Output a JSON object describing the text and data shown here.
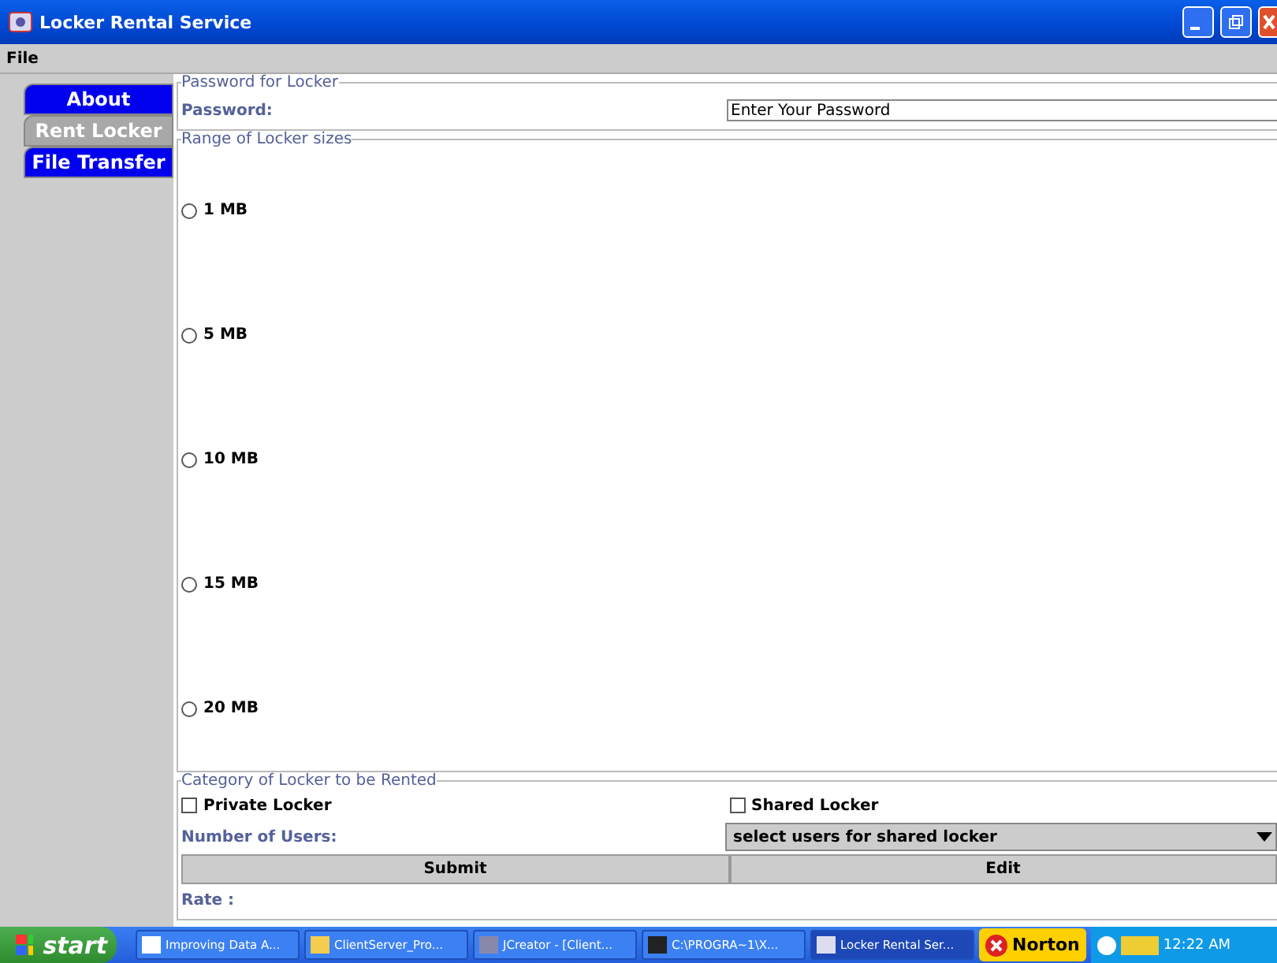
{
  "window": {
    "title": "Locker Rental Service"
  },
  "menu": [
    "File"
  ],
  "tabs": [
    {
      "label": "About",
      "selected": false
    },
    {
      "label": "Rent Locker",
      "selected": true
    },
    {
      "label": "File Transfer",
      "selected": false
    }
  ],
  "password_group": {
    "title": "Password for Locker",
    "label": "Password:",
    "value": "Enter Your Password"
  },
  "sizes_group": {
    "title": "Range of Locker sizes",
    "options": [
      {
        "label": "1 MB",
        "selected": false
      },
      {
        "label": "5 MB",
        "selected": false
      },
      {
        "label": "10 MB",
        "selected": false
      },
      {
        "label": "15 MB",
        "selected": false
      },
      {
        "label": "20 MB",
        "selected": false
      }
    ]
  },
  "category_group": {
    "title": "Category of Locker to be Rented",
    "checkboxes": [
      {
        "label": "Private Locker",
        "checked": false
      },
      {
        "label": "Shared Locker",
        "checked": false
      }
    ],
    "users_label": "Number of Users:",
    "users_select": "select users for shared locker",
    "buttons": [
      "Submit",
      "Edit"
    ],
    "rate_label": "Rate :"
  },
  "taskbar": {
    "start": "start",
    "tasks": [
      {
        "label": "Improving Data A...",
        "kind": "doc",
        "selected": false
      },
      {
        "label": "ClientServer_Pro...",
        "kind": "folder",
        "selected": false
      },
      {
        "label": "JCreator - [Client...",
        "kind": "ide",
        "selected": false
      },
      {
        "label": "C:\\PROGRA~1\\X...",
        "kind": "console",
        "selected": false
      },
      {
        "label": "Locker Rental Ser...",
        "kind": "app",
        "selected": true
      }
    ],
    "norton": "Norton",
    "clock": "12:22 AM"
  }
}
